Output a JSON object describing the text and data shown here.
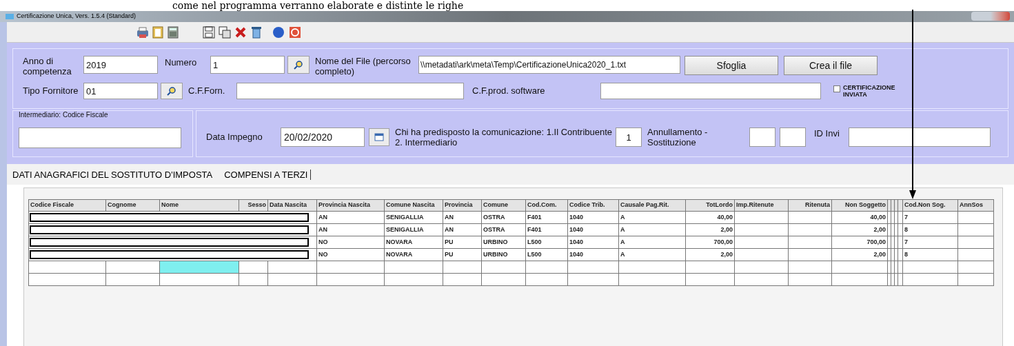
{
  "caption": "come nel programma verranno elaborate e distinte le righe",
  "window": {
    "title": "Certificazione Unica, Vers. 1.5.4 (Standard)"
  },
  "form": {
    "anno": {
      "label": "Anno di competenza",
      "value": "2019"
    },
    "numero": {
      "label": "Numero",
      "value": "1"
    },
    "nome_file": {
      "label": "Nome del File (percorso completo)",
      "value": "\\\\metadati\\ark\\meta\\Temp\\CertificazioneUnica2020_1.txt"
    },
    "sfoglia": "Sfoglia",
    "crea": "Crea il file",
    "tipo_fornitore": {
      "label": "Tipo Fornitore",
      "value": "01"
    },
    "cf_forn": {
      "label": "C.F.Forn."
    },
    "cf_software": {
      "label": "C.F.prod. software"
    },
    "inviata": {
      "label": "CERTIFICAZIONE INVIATA",
      "checked": false
    },
    "intermediario": {
      "legend": "Intermediario: Codice Fiscale"
    },
    "data_impegno": {
      "label": "Data Impegno",
      "value": "20/02/2020"
    },
    "chi": {
      "label": "Chi ha predisposto la comunicazione: 1.Il Contribuente  2. Intermediario",
      "value": "1"
    },
    "annullamento": {
      "label": "Annullamento - Sostituzione"
    },
    "id_invio": {
      "label": "ID Invi"
    }
  },
  "tabs": [
    {
      "label": "DATI ANAGRAFICI DEL SOSTITUTO D'IMPOSTA",
      "selected": false
    },
    {
      "label": "COMPENSI A TERZI",
      "selected": true
    }
  ],
  "table": {
    "columns": [
      "Codice Fiscale",
      "Cognome",
      "Nome",
      "Sesso",
      "Data Nascita",
      "Provincia Nascita",
      "Comune Nascita",
      "Provincia",
      "Comune",
      "Cod.Com.",
      "Codice Trib.",
      "Causale Pag.Rit.",
      "TotLordo",
      "Imp.Ritenute",
      "Ritenuta",
      "Non Soggetto",
      "Cod.Non Sog.",
      "AnnSos"
    ],
    "rows": [
      {
        "redacted": true,
        "selected": false,
        "cells": [
          null,
          null,
          null,
          null,
          null,
          "AN",
          "SENIGALLIA",
          "AN",
          "OSTRA",
          "F401",
          "1040",
          "A",
          "40,00",
          null,
          null,
          "40,00",
          "7",
          null
        ]
      },
      {
        "redacted": true,
        "selected": false,
        "cells": [
          null,
          null,
          null,
          null,
          null,
          "AN",
          "SENIGALLIA",
          "AN",
          "OSTRA",
          "F401",
          "1040",
          "A",
          "2,00",
          null,
          null,
          "2,00",
          "8",
          null
        ]
      },
      {
        "redacted": true,
        "selected": false,
        "cells": [
          null,
          null,
          null,
          null,
          null,
          "NO",
          "NOVARA",
          "PU",
          "URBINO",
          "L500",
          "1040",
          "A",
          "700,00",
          null,
          null,
          "700,00",
          "7",
          null
        ]
      },
      {
        "redacted": true,
        "selected": false,
        "cells": [
          null,
          null,
          null,
          null,
          null,
          "NO",
          "NOVARA",
          "PU",
          "URBINO",
          "L500",
          "1040",
          "A",
          "2,00",
          null,
          null,
          "2,00",
          "8",
          null
        ]
      },
      {
        "redacted": false,
        "selected": true,
        "cells": [
          null,
          null,
          null,
          null,
          null,
          null,
          null,
          null,
          null,
          null,
          null,
          null,
          null,
          null,
          null,
          null,
          null,
          null
        ]
      },
      {
        "redacted": false,
        "selected": false,
        "cells": [
          null,
          null,
          null,
          null,
          null,
          null,
          null,
          null,
          null,
          null,
          null,
          null,
          null,
          null,
          null,
          null,
          null,
          null
        ]
      }
    ]
  }
}
